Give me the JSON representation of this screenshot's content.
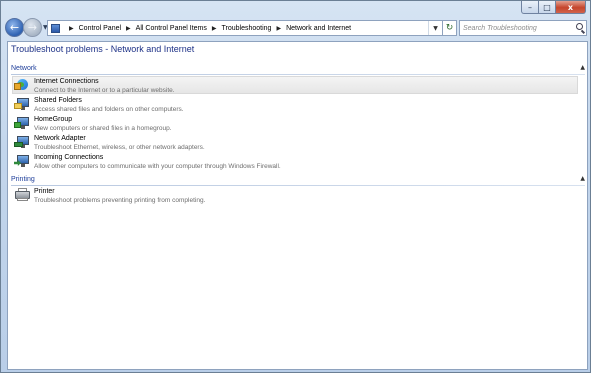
{
  "window": {
    "caption_buttons": {
      "minimize": "–",
      "maximize": "□",
      "close": "x"
    }
  },
  "nav": {
    "back_glyph": "←",
    "forward_glyph": "→",
    "breadcrumb": [
      "Control Panel",
      "All Control Panel Items",
      "Troubleshooting",
      "Network and Internet"
    ],
    "search_placeholder": "Search Troubleshooting"
  },
  "page": {
    "title": "Troubleshoot problems - Network and Internet"
  },
  "groups": [
    {
      "name": "Network",
      "items": [
        {
          "title": "Internet Connections",
          "desc": "Connect to the Internet or to a particular website.",
          "icon": "internet-connections-icon",
          "selected": true
        },
        {
          "title": "Shared Folders",
          "desc": "Access shared files and folders on other computers.",
          "icon": "shared-folders-icon"
        },
        {
          "title": "HomeGroup",
          "desc": "View computers or shared files in a homegroup.",
          "icon": "homegroup-icon"
        },
        {
          "title": "Network Adapter",
          "desc": "Troubleshoot Ethernet, wireless, or other network adapters.",
          "icon": "network-adapter-icon"
        },
        {
          "title": "Incoming Connections",
          "desc": "Allow other computers to communicate with your computer through Windows Firewall.",
          "icon": "incoming-connections-icon"
        }
      ]
    },
    {
      "name": "Printing",
      "items": [
        {
          "title": "Printer",
          "desc": "Troubleshoot problems preventing printing from completing.",
          "icon": "printer-icon"
        }
      ]
    }
  ],
  "colors": {
    "title_blue": "#1e3287",
    "group_blue": "#1e3e9a",
    "chrome": "#c3d6ec"
  }
}
